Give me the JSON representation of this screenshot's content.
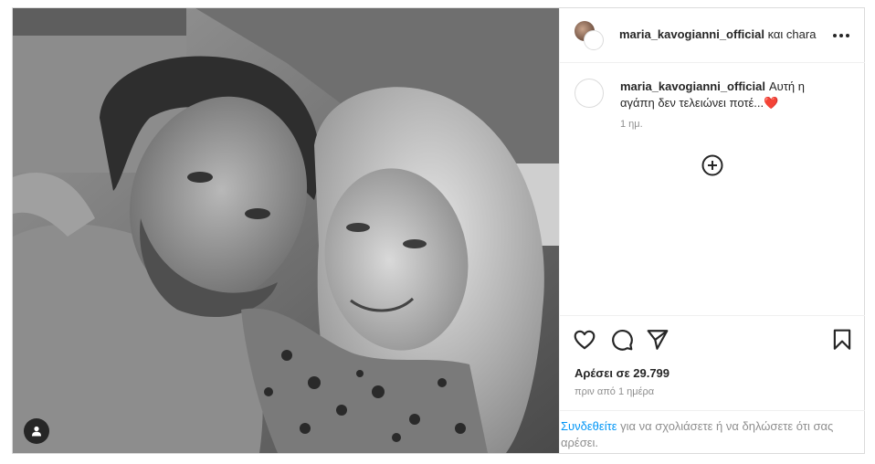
{
  "header": {
    "username": "maria_kavogianni_official",
    "collab_text": "και chara"
  },
  "caption": {
    "username": "maria_kavogianni_official",
    "text": "Αυτή η αγάπη δεν τελειώνει ποτέ...",
    "emoji": "❤️",
    "time_short": "1 ημ."
  },
  "actions": {
    "likes": "Αρέσει σε 29.799",
    "time_full": "πριν από 1 ημέρα"
  },
  "login_prompt": {
    "link_text": "Συνδεθείτε",
    "rest_text": " για να σχολιάσετε ή να δηλώσετε ότι σας αρέσει."
  },
  "icons": [
    "tag-user-icon",
    "more-options-icon",
    "add-comment-icon",
    "heart-icon",
    "comment-icon",
    "share-icon",
    "bookmark-icon"
  ],
  "colors": {
    "link": "#0095f6",
    "text": "#262626",
    "secondary": "#8e8e8e",
    "heart": "#ed4956"
  }
}
